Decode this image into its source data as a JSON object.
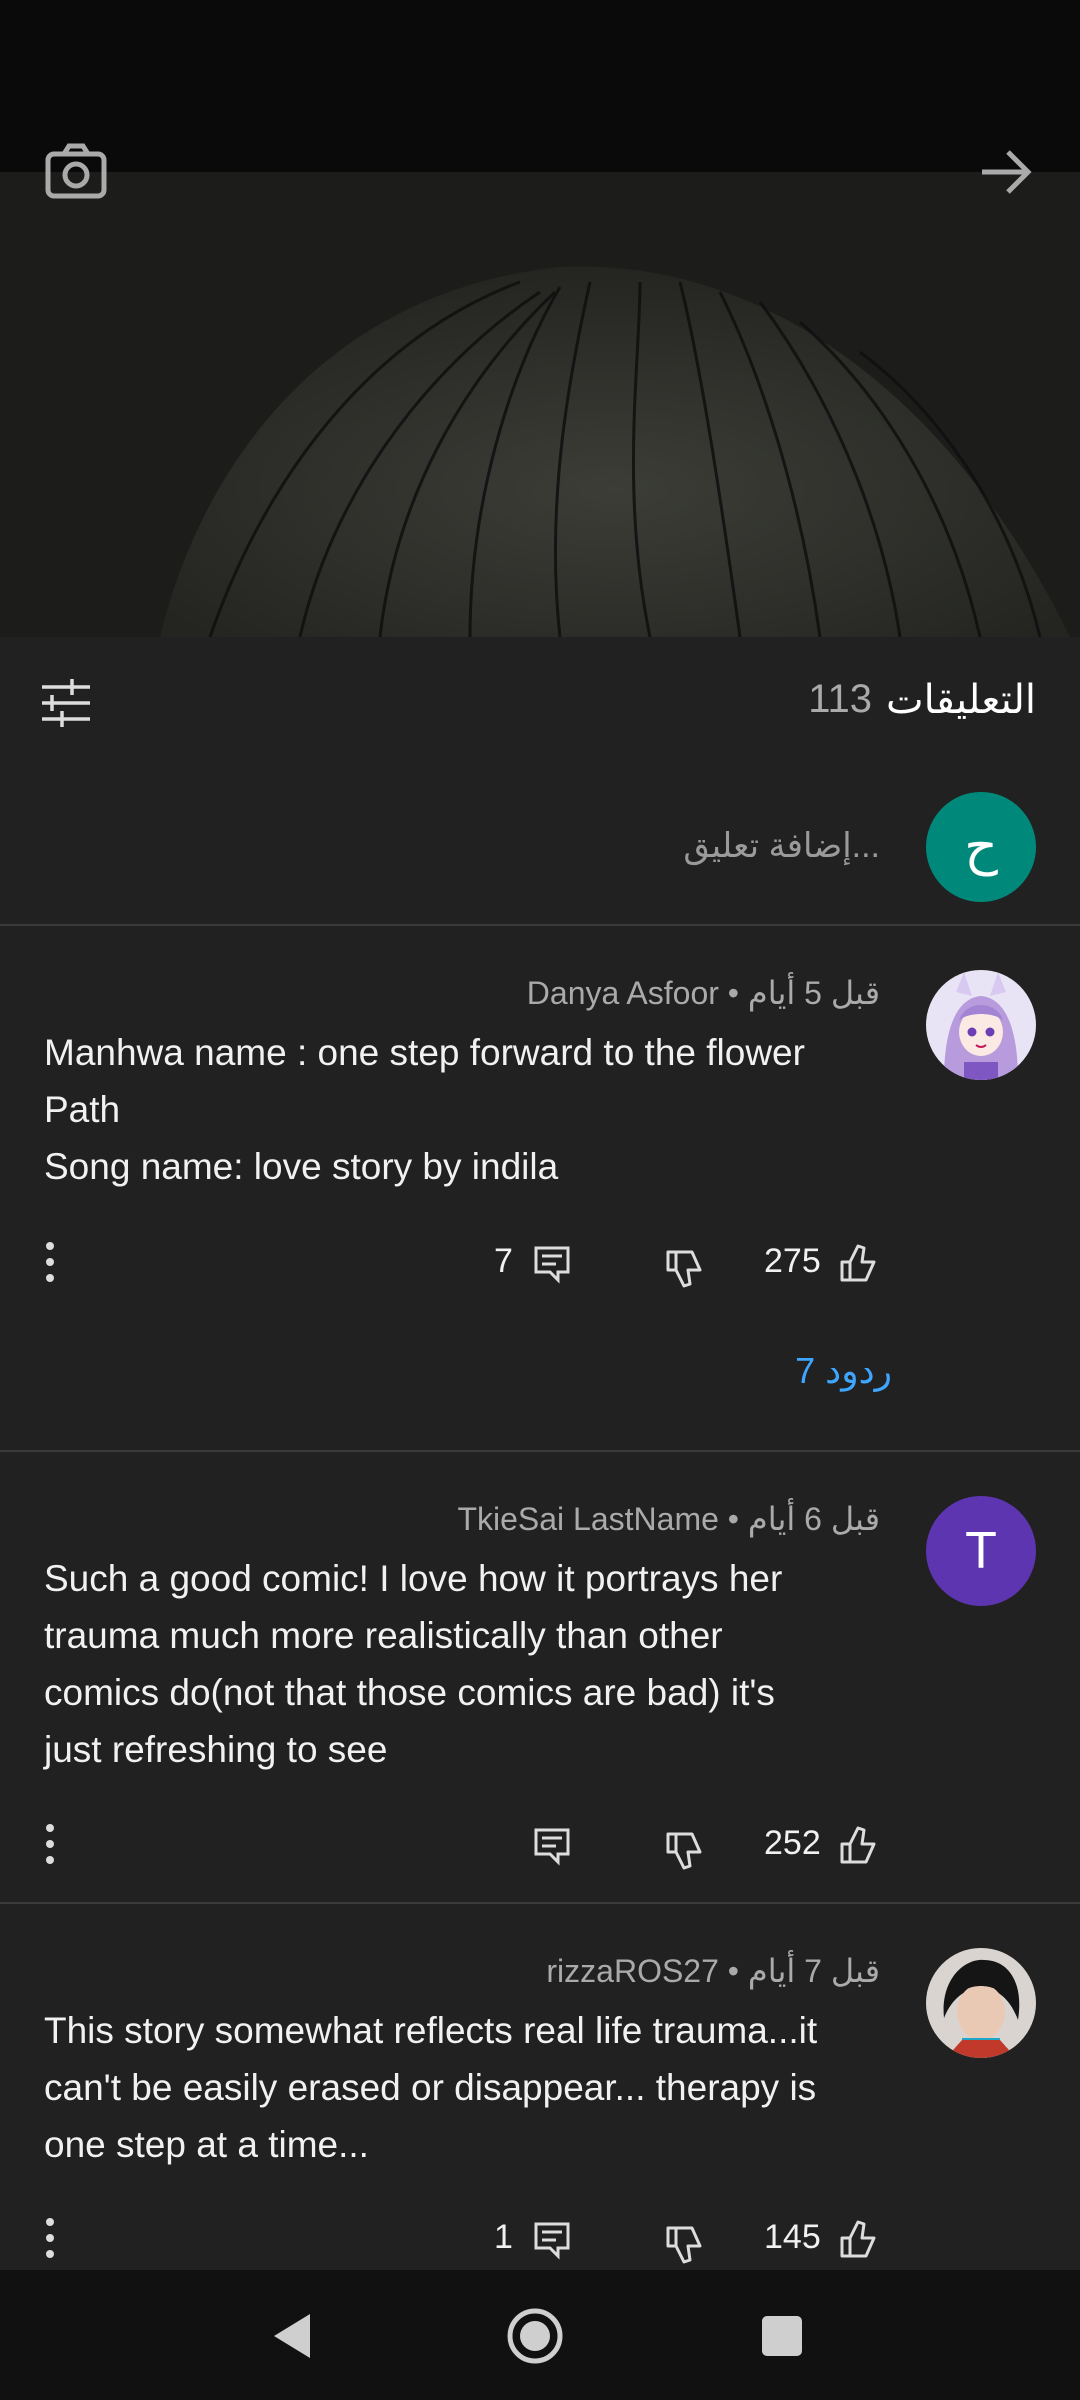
{
  "video": {
    "icons": [
      "camera-icon",
      "forward-arrow-icon"
    ]
  },
  "comments_header": {
    "title": "التعليقات",
    "count": "113",
    "filter_icon": "sliders-icon"
  },
  "add_comment": {
    "avatar_initial": "ح",
    "placeholder": "إضافة تعليق..."
  },
  "comments": [
    {
      "author": "Danya Asfoor",
      "time": "قبل 5 أيام",
      "separator": "•",
      "text_lines": [
        "Manhwa name : one step forward to the flower",
        "Path",
        "Song name: love story by indila"
      ],
      "likes": "275",
      "replies": "7",
      "replies_link": "7 ردود",
      "avatar": "anime-avatar"
    },
    {
      "author": "TkieSai LastName",
      "time": "قبل 6 أيام",
      "separator": "•",
      "text_lines": [
        "Such a good comic! I love how it portrays her",
        "trauma much more realistically than other",
        "comics do(not that those comics are bad) it's",
        "just refreshing to see"
      ],
      "likes": "252",
      "replies": "",
      "avatar_initial": "T",
      "avatar_color": "#5e35b1"
    },
    {
      "author": "rizzaROS27",
      "time": "قبل 7 أيام",
      "separator": "•",
      "text_lines": [
        "This story somewhat reflects real life trauma...it",
        "can't be easily erased or disappear... therapy is",
        "one step at a time..."
      ],
      "likes": "145",
      "replies": "1",
      "avatar": "photo-avatar"
    }
  ],
  "navbar": {
    "buttons": [
      "back-icon",
      "home-icon",
      "recents-icon"
    ]
  }
}
